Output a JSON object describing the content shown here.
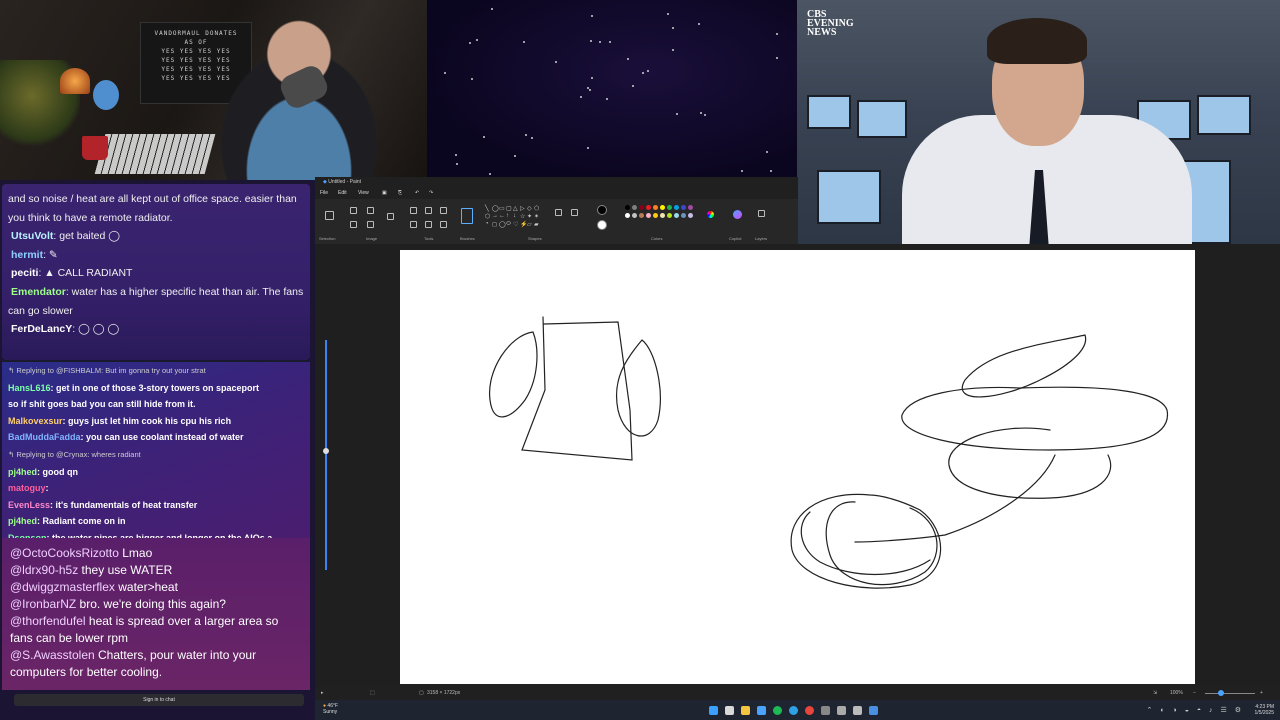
{
  "webcam": {
    "board_lines": [
      "VANDORMAUL DONATES",
      "AS OF",
      "YES YES YES YES",
      "YES YES YES YES",
      "YES YES YES YES",
      "YES YES YES YES"
    ]
  },
  "news": {
    "logo_line1": "CBS",
    "logo_line2": "EVENING",
    "logo_line3": "NEWS"
  },
  "chat_top": {
    "lines": [
      {
        "name": "",
        "name_color": "",
        "text": "and so noise / heat are all kept out of office space. easier than you think to have a remote radiator."
      },
      {
        "name": "UtsuVolt",
        "name_color": "#b9f0ff",
        "text": ": get baited ◯"
      },
      {
        "name": "hermit",
        "name_color": "#8fd0ff",
        "text": ": ✎"
      },
      {
        "name": "peciti",
        "name_color": "#ffffff",
        "text": ": ▲ CALL RADIANT"
      },
      {
        "name": "Emendator",
        "name_color": "#9dff8a",
        "text": ": water has a higher specific heat than air. The fans can go slower"
      },
      {
        "name": "FerDeLancY",
        "name_color": "#ffffff",
        "text": ": ◯ ◯ ◯"
      }
    ]
  },
  "chat_mid": {
    "lines": [
      {
        "reply": "↰ Replying to @FISHBALM: But im gonna try out your strat",
        "name": "",
        "name_color": "",
        "text": ""
      },
      {
        "reply": "",
        "name": "HansL616",
        "name_color": "#7dffa8",
        "text": ": get in one of those 3-story towers on spaceport"
      },
      {
        "reply": "",
        "name": "",
        "name_color": "",
        "text": "so if shit goes bad you can still hide from it."
      },
      {
        "reply": "",
        "name": "Malkovexsur",
        "name_color": "#ffcf6a",
        "text": ": guys just let him cook his cpu his rich"
      },
      {
        "reply": "",
        "name": "BadMuddaFadda",
        "name_color": "#7fb3ff",
        "text": ": you can use coolant instead of water"
      },
      {
        "reply": "↰ Replying to @Crynax: wheres radiant",
        "name": "",
        "name_color": "",
        "text": ""
      },
      {
        "reply": "",
        "name": "pj4hed",
        "name_color": "#9dff8a",
        "text": ": good qn"
      },
      {
        "reply": "",
        "name": "matoguy",
        "name_color": "#ff5f9a",
        "text": ":"
      },
      {
        "reply": "",
        "name": "EvenLess",
        "name_color": "#ff88c8",
        "text": ": it's fundamentals of heat transfer"
      },
      {
        "reply": "",
        "name": "pj4hed",
        "name_color": "#9dff8a",
        "text": ": Radiant come on in"
      },
      {
        "reply": "",
        "name": "Dsonson",
        "name_color": "#7dffa8",
        "text": ": the water pipes are bigger and longer on the AIOs a"
      }
    ]
  },
  "chat_bottom": {
    "lines": [
      {
        "name": "@OctoCooksRizotto",
        "text": " Lmao"
      },
      {
        "name": "@ldrx90-h5z",
        "text": " they use WATER"
      },
      {
        "name": "@dwiggzmasterflex",
        "text": " water>heat"
      },
      {
        "name": "@IronbarNZ",
        "text": " bro. we're doing this again?"
      },
      {
        "name": "@thorfendufel",
        "text": " heat is spread over a larger area so fans can be lower rpm"
      },
      {
        "name": "@S.Awasstolen",
        "text": " Chatters, pour water into your computers for better cooling."
      }
    ],
    "sign_in": "Sign in to chat"
  },
  "paint": {
    "title": "Untitled - Paint",
    "menu": [
      "File",
      "Edit",
      "View"
    ],
    "groups": [
      "Selection",
      "Image",
      "Tools",
      "Brushes",
      "Shapes",
      "Colors",
      "Copilot",
      "Layers"
    ],
    "status_size": "3158 × 1722px",
    "zoom": "100%",
    "colors": [
      "#000000",
      "#7f7f7f",
      "#880015",
      "#ed1c24",
      "#ff7f27",
      "#fff200",
      "#22b14c",
      "#00a2e8",
      "#3f48cc",
      "#a349a4",
      "#ffffff",
      "#c3c3c3",
      "#b97a57",
      "#ffaec9",
      "#ffc90e",
      "#efe4b0",
      "#b5e61d",
      "#99d9ea",
      "#7092be",
      "#c8bfe7"
    ]
  },
  "taskbar": {
    "weather_temp": "46°F",
    "weather_desc": "Sunny",
    "time": "4:23 PM",
    "date": "1/5/2025"
  }
}
